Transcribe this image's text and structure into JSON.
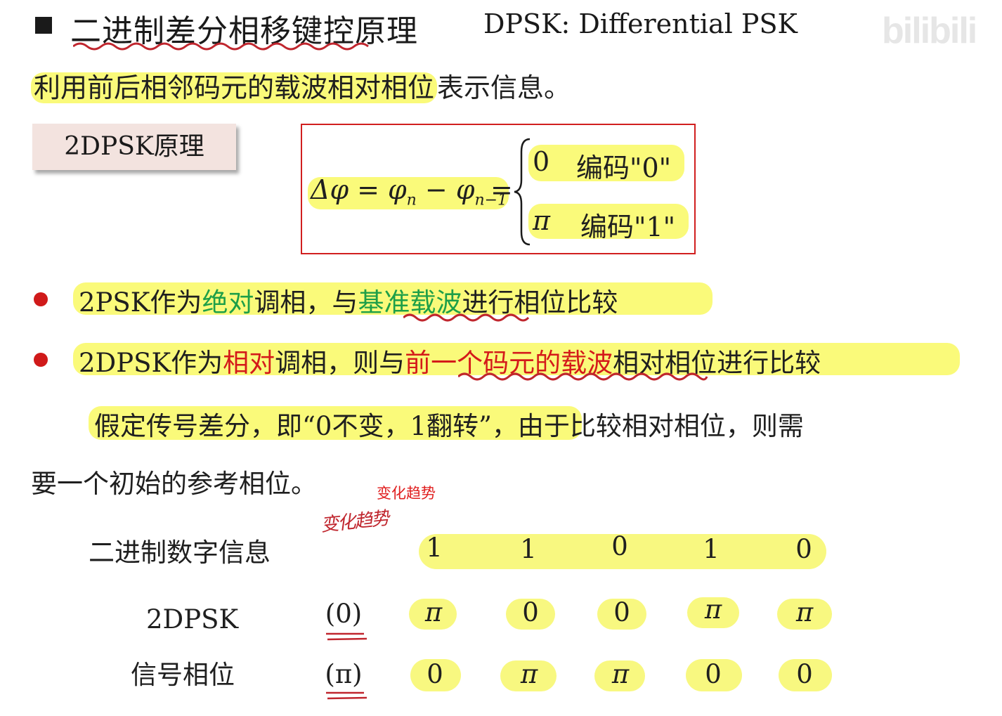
{
  "header": {
    "title_cn": "二进制差分相移键控原理",
    "title_en": "DPSK: Differential PSK",
    "watermark": "bilibili"
  },
  "intro": {
    "text_highlighted": "利用前后相邻码元的载波相对相位",
    "text_rest": "表示信息。"
  },
  "principle_label": "2DPSK原理",
  "formula": {
    "lhs": "Δφ = φ",
    "sub_n": "n",
    "minus": " − φ",
    "sub_n1": "n−1",
    "eq": "=",
    "case0_value": "0",
    "case0_desc": "编码\"0\"",
    "case1_value": "π",
    "case1_desc": "编码\"1\""
  },
  "bullets": [
    {
      "p1": "2PSK作为",
      "p2": "绝对",
      "p3": "调相，与",
      "p4": "基准载波",
      "p5": "进行相位比较"
    },
    {
      "p1": "2DPSK作为",
      "p2": "相对",
      "p3": "调相，则与",
      "p4": "前一个码元的载波",
      "p5": "相对相位进行比较"
    }
  ],
  "paragraph": {
    "line1_highlighted": "假定传号差分，即“0不变，1翻转”",
    "line1_rest": "，由于比较相对相位，则需",
    "line2": "要一个初始的参考相位。"
  },
  "annotation_typed": "变化趋势",
  "annotation_handwritten": "变化趋势",
  "table": {
    "binary_label": "二进制数字信息",
    "binary_values": [
      "1",
      "1",
      "0",
      "1",
      "0"
    ],
    "phase_label_line1": "2DPSK",
    "phase_label_line2": "信号相位",
    "row_a_init": "(0)",
    "row_a_values": [
      "π",
      "0",
      "0",
      "π",
      "π"
    ],
    "row_b_init": "(π)",
    "row_b_values": [
      "0",
      "π",
      "π",
      "0",
      "0"
    ]
  },
  "colors": {
    "highlight": "#fafa7a",
    "accent_red": "#d41a1a",
    "accent_green": "#1e9f48",
    "box_border": "#d11f1f"
  }
}
